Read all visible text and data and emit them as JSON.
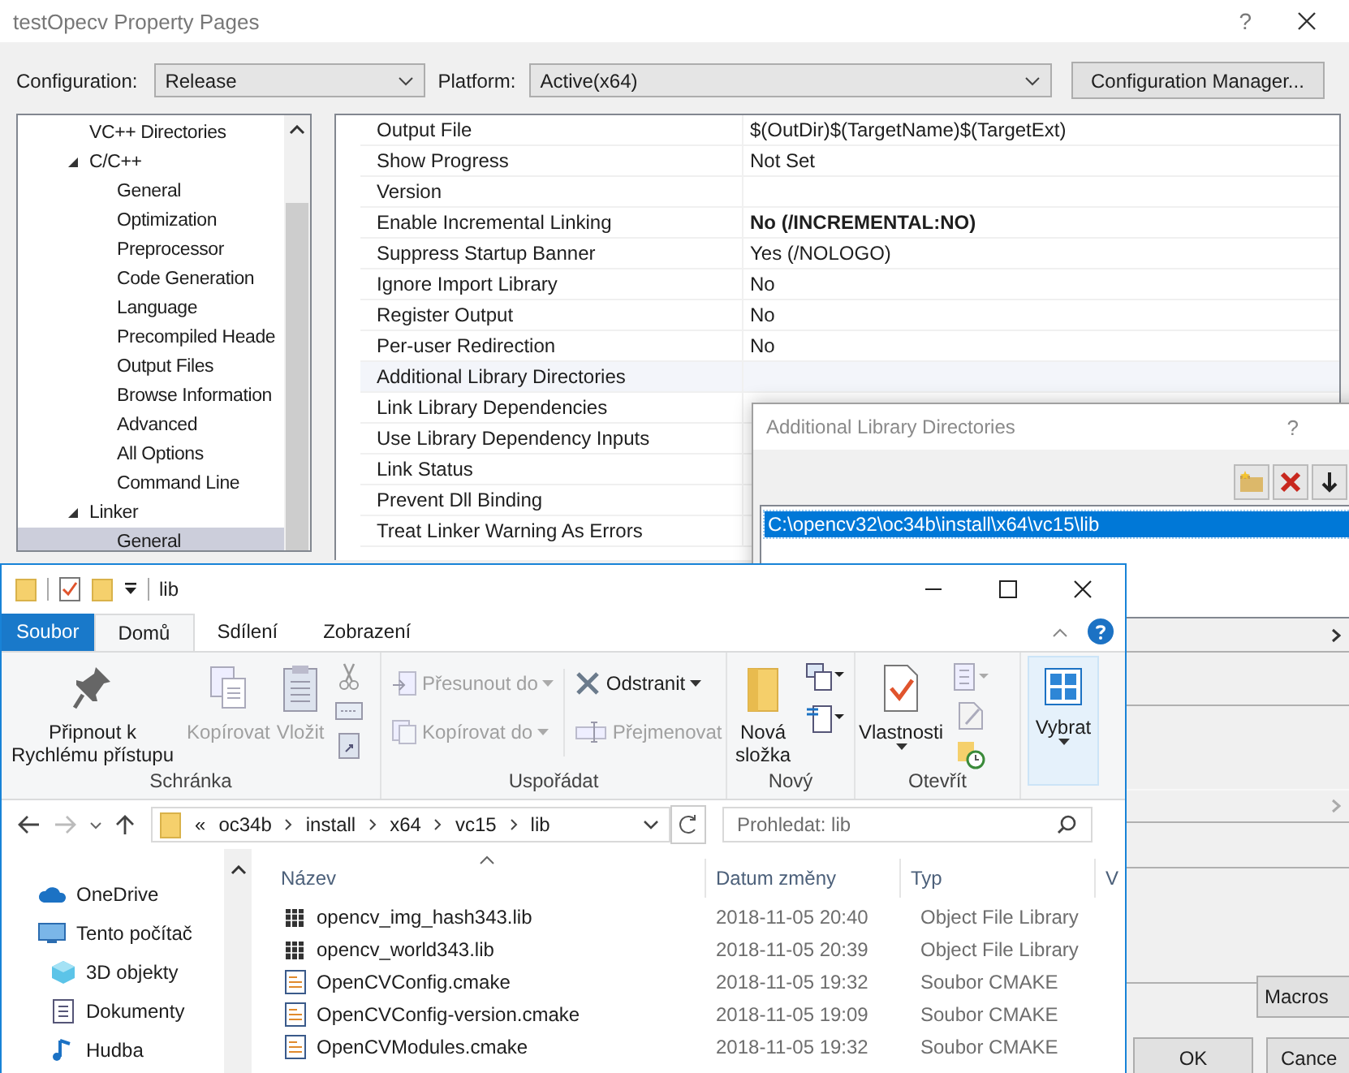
{
  "property_pages": {
    "title": "testOpecv Property Pages",
    "help": "?",
    "configuration_label": "Configuration:",
    "configuration": "Release",
    "platform_label": "Platform:",
    "platform": "Active(x64)",
    "config_manager_button": "Configuration Manager...",
    "tree": [
      {
        "label": "VC++ Directories",
        "selected": false
      },
      {
        "label": "C/C++",
        "selected": false,
        "expanded": true,
        "children": [
          {
            "label": "General",
            "selected": false
          },
          {
            "label": "Optimization",
            "selected": false
          },
          {
            "label": "Preprocessor",
            "selected": false
          },
          {
            "label": "Code Generation",
            "selected": false
          },
          {
            "label": "Language",
            "selected": false
          },
          {
            "label": "Precompiled Heade",
            "selected": false
          },
          {
            "label": "Output Files",
            "selected": false
          },
          {
            "label": "Browse Information",
            "selected": false
          },
          {
            "label": "Advanced",
            "selected": false
          },
          {
            "label": "All Options",
            "selected": false
          },
          {
            "label": "Command Line",
            "selected": false
          }
        ]
      },
      {
        "label": "Linker",
        "selected": false,
        "expanded": true,
        "children": [
          {
            "label": "General",
            "selected": true
          }
        ]
      }
    ],
    "properties": [
      {
        "name": "Output File",
        "value": "$(OutDir)$(TargetName)$(TargetExt)",
        "bold": false,
        "selected": false
      },
      {
        "name": "Show Progress",
        "value": "Not Set",
        "bold": false,
        "selected": false
      },
      {
        "name": "Version",
        "selected": false
      },
      {
        "name": "Enable Incremental Linking",
        "value": "No (/INCREMENTAL:NO)",
        "bold": true,
        "selected": false
      },
      {
        "name": "Suppress Startup Banner",
        "value": "Yes (/NOLOGO)",
        "bold": false,
        "selected": false
      },
      {
        "name": "Ignore Import Library",
        "value": "No",
        "bold": false,
        "selected": false
      },
      {
        "name": "Register Output",
        "value": "No",
        "bold": false,
        "selected": false
      },
      {
        "name": "Per-user Redirection",
        "value": "No",
        "bold": false,
        "selected": false
      },
      {
        "name": "Additional Library Directories",
        "selected": true
      },
      {
        "name": "Link Library Dependencies",
        "selected": false
      },
      {
        "name": "Use Library Dependency Inputs",
        "selected": false
      },
      {
        "name": "Link Status",
        "selected": false
      },
      {
        "name": "Prevent Dll Binding",
        "selected": false
      },
      {
        "name": "Treat Linker Warning As Errors",
        "selected": false
      }
    ]
  },
  "library_dialog": {
    "title": "Additional Library Directories",
    "help": "?",
    "directories": [
      {
        "path": "C:\\opencv32\\oc34b\\install\\x64\\vc15\\lib",
        "selected": true
      }
    ],
    "macros_button": "Macros",
    "ok_button": "OK",
    "cancel_button": "Cance"
  },
  "explorer": {
    "title": "lib",
    "tabs": [
      {
        "label": "Soubor",
        "kind": "file",
        "selected": false
      },
      {
        "label": "Domů",
        "kind": "tab",
        "selected": true
      },
      {
        "label": "Sdílení",
        "kind": "tab",
        "selected": false
      },
      {
        "label": "Zobrazení",
        "kind": "tab",
        "selected": false
      }
    ],
    "ribbon": {
      "pin": {
        "label": "Připnout k Rychlému přístupu",
        "disabled": false
      },
      "copy": {
        "label": "Kopírovat",
        "disabled": true
      },
      "paste": {
        "label": "Vložit",
        "disabled": true
      },
      "clipboard_group": "Schránka",
      "move_to": {
        "label": "Přesunout do",
        "disabled": true
      },
      "copy_to": {
        "label": "Kopírovat do",
        "disabled": true
      },
      "delete": {
        "label": "Odstranit",
        "disabled": false
      },
      "rename": {
        "label": "Přejmenovat",
        "disabled": true
      },
      "organize_group": "Uspořádat",
      "new_folder": {
        "label": "Nová složka",
        "disabled": false
      },
      "new_group": "Nový",
      "properties": {
        "label": "Vlastnosti",
        "disabled": false
      },
      "open_group": "Otevřít",
      "select": {
        "label": "Vybrat",
        "disabled": false
      }
    },
    "breadcrumb_overflow": "«",
    "breadcrumb": [
      "oc34b",
      "install",
      "x64",
      "vc15",
      "lib"
    ],
    "search": {
      "placeholder": "Prohledat: lib"
    },
    "navigation": [
      {
        "label": "OneDrive",
        "kind": "cloud"
      },
      {
        "label": "Tento počítač",
        "kind": "computer",
        "children": [
          {
            "label": "3D objekty",
            "kind": "cube"
          },
          {
            "label": "Dokumenty",
            "kind": "documents"
          },
          {
            "label": "Hudba",
            "kind": "music"
          }
        ]
      }
    ],
    "columns": [
      "Název",
      "Datum změny",
      "Typ",
      "V"
    ],
    "files": [
      {
        "name": "opencv_img_hash343.lib",
        "date": "2018-11-05 20:40",
        "type": "Object File Library",
        "kind": "lib"
      },
      {
        "name": "opencv_world343.lib",
        "date": "2018-11-05 20:39",
        "type": "Object File Library",
        "kind": "lib"
      },
      {
        "name": "OpenCVConfig.cmake",
        "date": "2018-11-05 19:32",
        "type": "Soubor CMAKE",
        "kind": "cmake"
      },
      {
        "name": "OpenCVConfig-version.cmake",
        "date": "2018-11-05 19:09",
        "type": "Soubor CMAKE",
        "kind": "cmake"
      },
      {
        "name": "OpenCVModules.cmake",
        "date": "2018-11-05 19:32",
        "type": "Soubor CMAKE",
        "kind": "cmake"
      }
    ]
  }
}
